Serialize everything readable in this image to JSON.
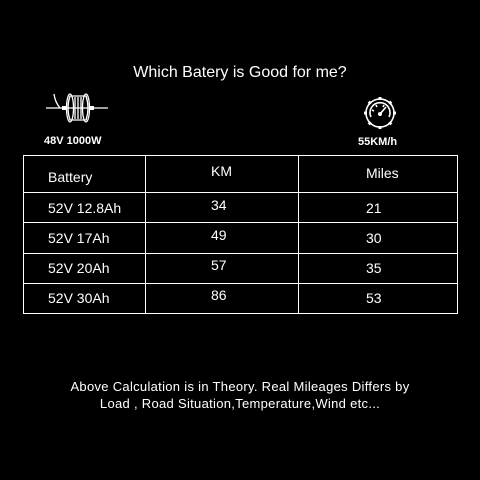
{
  "title": "Which Batery is Good for me?",
  "motor": {
    "icon": "hub-motor-icon",
    "label": "48V 1000W"
  },
  "speed": {
    "icon": "speedometer-gear-icon",
    "label": "55KM/h"
  },
  "table": {
    "headers": [
      "Battery",
      "KM",
      "Miles"
    ],
    "rows": [
      [
        "52V 12.8Ah",
        "34",
        "21"
      ],
      [
        "52V 17Ah",
        "49",
        "30"
      ],
      [
        "52V 20Ah",
        "57",
        "35"
      ],
      [
        "52V 30Ah",
        "86",
        "53"
      ]
    ]
  },
  "note": {
    "line1": "Above Calculation is in Theory. Real Mileages Differs by",
    "line2": "Load , Road Situation,Temperature,Wind etc..."
  },
  "colors": {
    "background": "#000000",
    "foreground": "#ffffff"
  }
}
